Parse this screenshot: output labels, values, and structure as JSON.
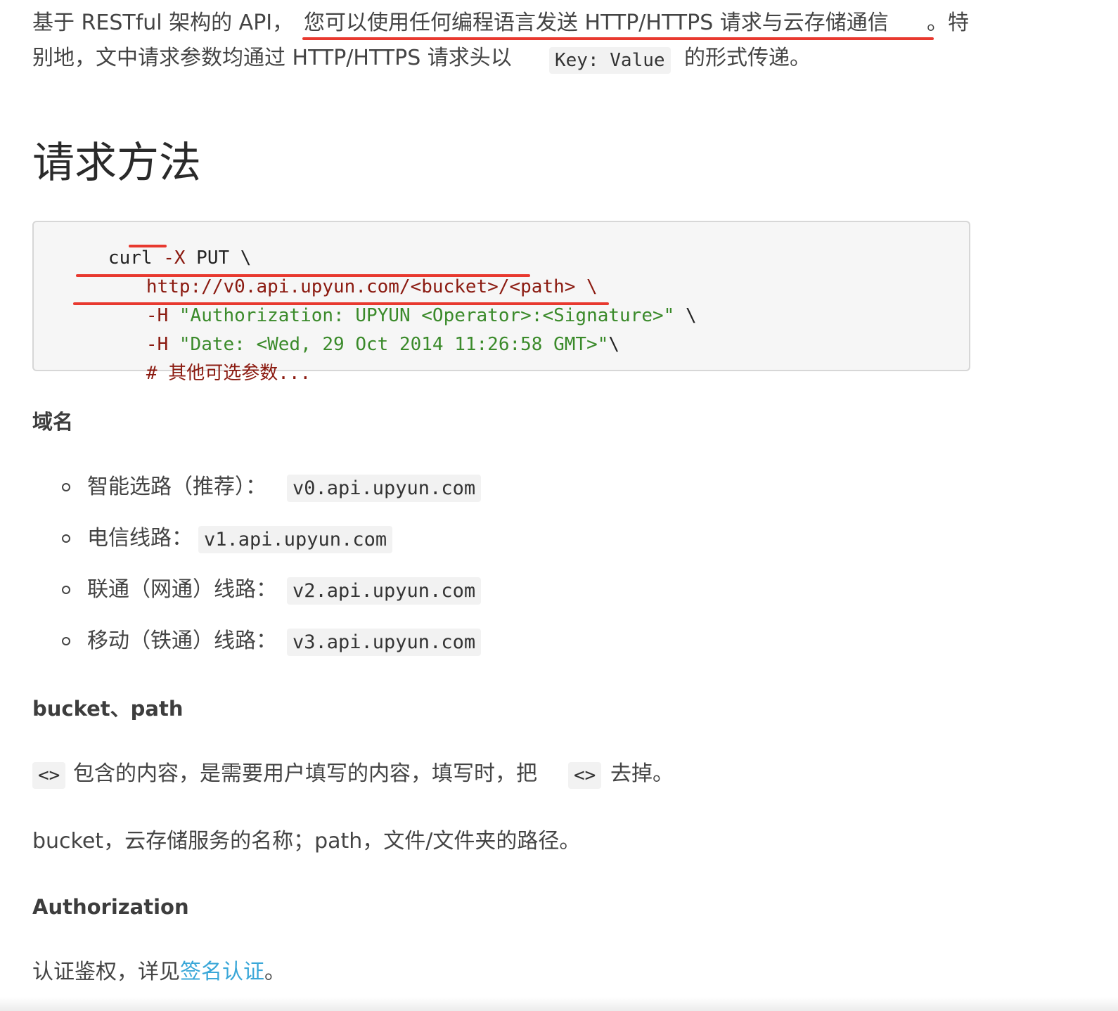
{
  "intro": {
    "line1_a": "基于 RESTful 架构的 API，",
    "line1_b": "您可以使用任何编程语言发送 HTTP/HTTPS 请求与云存储通信",
    "line1_c": "。特",
    "line2_a": "别地，文中请求参数均通过 HTTP/HTTPS 请求头以",
    "line2_code": "Key: Value",
    "line2_b": "的形式传递。"
  },
  "section_title": "请求方法",
  "code": {
    "l1_cmd": "curl ",
    "l1_flag": "-X ",
    "l1_method": "PUT",
    "l1_tail": " \\",
    "l2_url": "http://v0.api.upyun.com/<bucket>/<path>",
    "l2_tail": " \\",
    "l3_flag": "-H ",
    "l3_str": "\"Authorization: UPYUN <Operator>:<Signature>\"",
    "l3_tail": " \\",
    "l4_flag": "-H ",
    "l4_str": "\"Date: <Wed, 29 Oct 2014 11:26:58 GMT>\"",
    "l4_tail": "\\",
    "l5_comment": "# 其他可选参数..."
  },
  "domain": {
    "heading": "域名",
    "items": [
      {
        "label": "智能选路（推荐）：",
        "host": "v0.api.upyun.com"
      },
      {
        "label": "电信线路：",
        "host": "v1.api.upyun.com"
      },
      {
        "label": "联通（网通）线路：",
        "host": "v2.api.upyun.com"
      },
      {
        "label": "移动（铁通）线路：",
        "host": "v3.api.upyun.com"
      }
    ]
  },
  "bucket_path": {
    "heading": "bucket、path",
    "p1_code_a": "<>",
    "p1_text_a": "包含的内容，是需要用户填写的内容，填写时，把",
    "p1_code_b": "<>",
    "p1_text_b": "去掉。",
    "p2": "bucket，云存储服务的名称；path，文件/文件夹的路径。"
  },
  "authorization": {
    "heading": "Authorization",
    "text_a": "认证鉴权，详见",
    "link": "签名认证",
    "text_b": "。"
  },
  "colors": {
    "annotation_red": "#e8392f",
    "link_blue": "#3aa7d8",
    "string_green": "#3a8a2a"
  }
}
